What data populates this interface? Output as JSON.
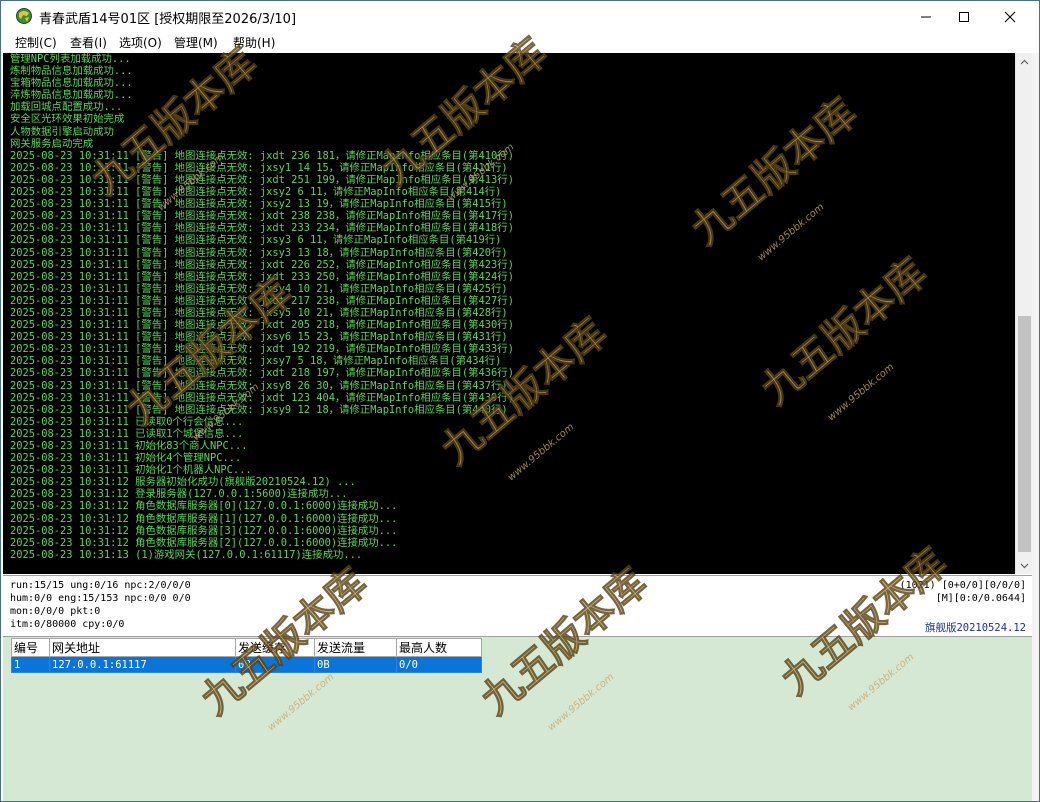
{
  "window": {
    "title": "青春武盾14号01区 [授权期限至2026/3/10]",
    "controls": {
      "minimize": "—",
      "maximize": "☐",
      "close": "✕"
    }
  },
  "menu": [
    {
      "label": "控制(C)"
    },
    {
      "label": "查看(I)"
    },
    {
      "label": "选项(O)"
    },
    {
      "label": "管理(M)"
    },
    {
      "label": "帮助(H)"
    }
  ],
  "console": {
    "lines": [
      "管理NPC列表加载成功...",
      "炼制物品信息加载成功...",
      "宝箱物品信息加载成功...",
      "淬炼物品信息加载成功...",
      "加载回城点配置成功...",
      "安全区光环效果初始完成",
      "人物数据引擎启动成功",
      "网关服务启动完成",
      "2025-08-23 10:31:11 [警告] 地图连接点无效: jxdt 236 181，请修正MapInfo相应条目(第410行)",
      "2025-08-23 10:31:11 [警告] 地图连接点无效: jxsy1 14 15，请修正MapInfo相应条目(第411行)",
      "2025-08-23 10:31:11 [警告] 地图连接点无效: jxdt 251 199，请修正MapInfo相应条目(第413行)",
      "2025-08-23 10:31:11 [警告] 地图连接点无效: jxsy2 6 11，请修正MapInfo相应条目(第414行)",
      "2025-08-23 10:31:11 [警告] 地图连接点无效: jxsy2 13 19，请修正MapInfo相应条目(第415行)",
      "2025-08-23 10:31:11 [警告] 地图连接点无效: jxdt 238 238，请修正MapInfo相应条目(第417行)",
      "2025-08-23 10:31:11 [警告] 地图连接点无效: jxdt 233 234，请修正MapInfo相应条目(第418行)",
      "2025-08-23 10:31:11 [警告] 地图连接点无效: jxsy3 6 11，请修正MapInfo相应条目(第419行)",
      "2025-08-23 10:31:11 [警告] 地图连接点无效: jxsy3 13 18，请修正MapInfo相应条目(第420行)",
      "2025-08-23 10:31:11 [警告] 地图连接点无效: jxdt 226 252，请修正MapInfo相应条目(第423行)",
      "2025-08-23 10:31:11 [警告] 地图连接点无效: jxdt 233 250，请修正MapInfo相应条目(第424行)",
      "2025-08-23 10:31:11 [警告] 地图连接点无效: jxsy4 10 21，请修正MapInfo相应条目(第425行)",
      "2025-08-23 10:31:11 [警告] 地图连接点无效: jxdt 217 238，请修正MapInfo相应条目(第427行)",
      "2025-08-23 10:31:11 [警告] 地图连接点无效: jxsy5 10 21，请修正MapInfo相应条目(第428行)",
      "2025-08-23 10:31:11 [警告] 地图连接点无效: jxdt 205 218，请修正MapInfo相应条目(第430行)",
      "2025-08-23 10:31:11 [警告] 地图连接点无效: jxsy6 15 23，请修正MapInfo相应条目(第431行)",
      "2025-08-23 10:31:11 [警告] 地图连接点无效: jxdt 192 219，请修正MapInfo相应条目(第433行)",
      "2025-08-23 10:31:11 [警告] 地图连接点无效: jxsy7 5 18，请修正MapInfo相应条目(第434行)",
      "2025-08-23 10:31:11 [警告] 地图连接点无效: jxdt 218 197，请修正MapInfo相应条目(第436行)",
      "2025-08-23 10:31:11 [警告] 地图连接点无效: jxsy8 26 30，请修正MapInfo相应条目(第437行)",
      "2025-08-23 10:31:11 [警告] 地图连接点无效: jxdt 123 404，请修正MapInfo相应条目(第439行)",
      "2025-08-23 10:31:11 [警告] 地图连接点无效: jxsy9 12 18，请修正MapInfo相应条目(第440行)",
      "2025-08-23 10:31:11 已读取0个行会信息...",
      "2025-08-23 10:31:11 已读取1个城堡信息...",
      "2025-08-23 10:31:11 初始化83个商人NPC...",
      "2025-08-23 10:31:11 初始化4个管理NPC...",
      "2025-08-23 10:31:11 初始化1个机器人NPC...",
      "2025-08-23 10:31:12 服务器初始化成功(旗舰版20210524.12) ...",
      "2025-08-23 10:31:12 登录服务器(127.0.0.1:5600)连接成功...",
      "2025-08-23 10:31:12 角色数据库服务器[0](127.0.0.1:6000)连接成功...",
      "2025-08-23 10:31:12 角色数据库服务器[1](127.0.0.1:6000)连接成功...",
      "2025-08-23 10:31:12 角色数据库服务器[3](127.0.0.1:6000)连接成功...",
      "2025-08-23 10:31:12 角色数据库服务器[2](127.0.0.1:6000)连接成功...",
      "2025-08-23 10:31:13 (1)游戏网关(127.0.0.1:61117)连接成功..."
    ]
  },
  "status": {
    "line1": "run:15/15 ung:0/16 npc:2/0/0/0",
    "line2": "hum:0/0 eng:15/153 npc:0/0 0/0",
    "line3": "mon:0/0/0 pkt:0",
    "line4": "itm:0/80000 cpy:0/0",
    "right1": "(1021) [0+0/0][0/0/0]",
    "right2": "[M][0:0/0.0644]",
    "version": "旗舰版20210524.12"
  },
  "gateway_table": {
    "headers": [
      "编号",
      "网关地址",
      "发送缓存",
      "发送流量",
      "最高人数"
    ],
    "rows": [
      [
        "1",
        "127.0.0.1:61117",
        "0B",
        "0B",
        "0/0"
      ]
    ]
  },
  "watermark": {
    "text": "九五版本库",
    "url": "www.95bbk.com"
  }
}
